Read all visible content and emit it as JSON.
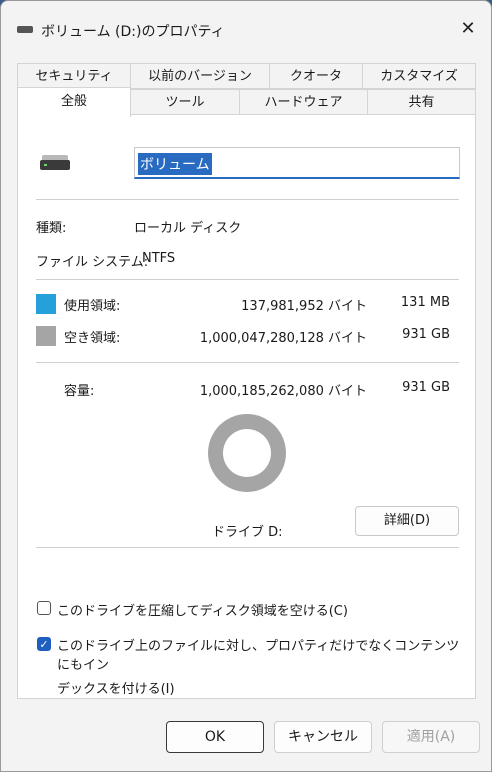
{
  "window": {
    "title": "ボリューム (D:)のプロパティ"
  },
  "tabs_row1": [
    "セキュリティ",
    "以前のバージョン",
    "クオータ",
    "カスタマイズ"
  ],
  "tabs_row2": [
    "全般",
    "ツール",
    "ハードウェア",
    "共有"
  ],
  "general": {
    "name_value": "ボリューム",
    "type_label": "種類:",
    "type_value": "ローカル ディスク",
    "fs_label": "ファイル システム:",
    "fs_value": "NTFS",
    "used_label": "使用領域:",
    "used_bytes": "137,981,952 バイト",
    "used_size": "131 MB",
    "free_label": "空き領域:",
    "free_bytes": "1,000,047,280,128 バイト",
    "free_size": "931 GB",
    "capacity_label": "容量:",
    "capacity_bytes": "1,000,185,262,080 バイト",
    "capacity_size": "931 GB",
    "drive_label": "ドライブ D:",
    "details_button": "詳細(D)",
    "compress_label": "このドライブを圧縮してディスク領域を空ける(C)",
    "index_label_line1": "このドライブ上のファイルに対し、プロパティだけでなくコンテンツにもイン",
    "index_label_line2": "デックスを付ける(I)",
    "used_fraction": 0.000138,
    "colors": {
      "used": "#26a0da",
      "free": "#a5a5a5"
    }
  },
  "buttons": {
    "ok": "OK",
    "cancel": "キャンセル",
    "apply": "適用(A)"
  }
}
